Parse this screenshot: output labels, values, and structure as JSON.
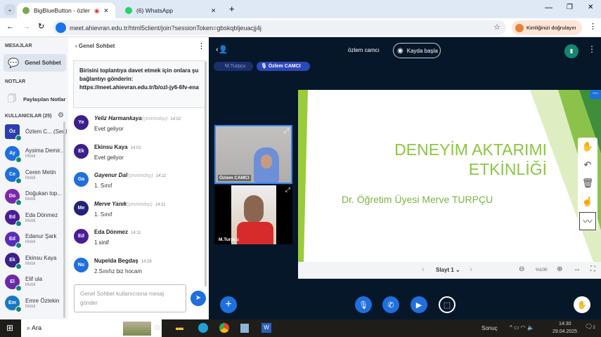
{
  "browser": {
    "tabs": [
      {
        "label": "BigBlueButton - özlem camcı"
      },
      {
        "label": "(6) WhatsApp"
      }
    ],
    "url": "meet.ahievran.edu.tr/html5client/join?sessionToken=gbskqbljeuacjj4j",
    "profile_label": "Kimliğinizi doğrulayın"
  },
  "sidebar": {
    "messages_header": "MESAJLAR",
    "public_chat": "Genel Sohbet",
    "notes_header": "NOTLAR",
    "shared_notes": "Paylaşılan Notlar",
    "users_header": "KULLANICILAR (25)",
    "users": [
      {
        "initials": "Öz",
        "name": "Özlem C...",
        "you": "(Sen)",
        "sub": "",
        "color": "#2e3dad"
      },
      {
        "initials": "Ay",
        "name": "Aysima Demir...",
        "sub": "Mobil",
        "color": "#1f6fdd"
      },
      {
        "initials": "Ce",
        "name": "Ceren Metin",
        "sub": "Mobil",
        "color": "#1f6fdd"
      },
      {
        "initials": "Do",
        "name": "Doğukan top...",
        "sub": "Mobil",
        "color": "#7a2aa8"
      },
      {
        "initials": "Ed",
        "name": "Eda Dönmez",
        "sub": "Mobil",
        "color": "#4a1d96"
      },
      {
        "initials": "Ed",
        "name": "Edanur Şark",
        "sub": "Mobil",
        "color": "#5b2cb8"
      },
      {
        "initials": "Ek",
        "name": "Ekinsu Kaya",
        "sub": "Mobil",
        "color": "#3b1f8c"
      },
      {
        "initials": "El",
        "name": "Elif ula",
        "sub": "Mobil",
        "color": "#6a2aa8"
      },
      {
        "initials": "Em",
        "name": "Emre Öztekin",
        "sub": "Mobil",
        "color": "#1a78c2"
      }
    ]
  },
  "chat": {
    "title": "Genel Sohbet",
    "invite": "Birisini toplantıya davet etmek için onlara şu bağlantıyı gönderin: https://meet.ahievran.edu.tr/b/ozl-jy6-6fv-ena",
    "messages": [
      {
        "initials": "Ye",
        "name": "Yeliz Harmankaya",
        "offline": "(çevrimdışı)",
        "time": "14:02",
        "text": "Evet geliyor",
        "color": "#3b1f8c"
      },
      {
        "initials": "Ek",
        "name": "Ekinsu Kaya",
        "offline": "",
        "time": "14:02",
        "text": "Evet geliyor",
        "color": "#3b1f8c"
      },
      {
        "initials": "Ga",
        "name": "Gayenur Dal",
        "offline": "(çevrimdışı)",
        "time": "14:11",
        "text": "1. Sınıf",
        "color": "#1f6fdd"
      },
      {
        "initials": "Me",
        "name": "Merve Yanık",
        "offline": "(çevrimdışı)",
        "time": "14:11",
        "text": "1. Sınıf",
        "color": "#25207a"
      },
      {
        "initials": "Ed",
        "name": "Eda Dönmez",
        "offline": "",
        "time": "14:11",
        "text": "1.sinif",
        "color": "#4a1d96"
      },
      {
        "initials": "Nu",
        "name": "Nupelda Begdaş",
        "offline": "",
        "time": "14:28",
        "text": "2.Sınıfız biz hocam",
        "color": "#1f6fdd"
      }
    ],
    "placeholder": "Genel Sohbet kullanıcısına mesaj gönder"
  },
  "meeting": {
    "title": "özlem camcı",
    "record": "Kayda başla",
    "talkers": [
      "M.Turpçu",
      "Özlem CAMCI"
    ],
    "videos": [
      "Özlem CAMCI",
      "M.Turpçu"
    ]
  },
  "slide": {
    "title1": "DENEYİM AKTARIMI",
    "title2": "ETKİNLİĞİ",
    "subtitle": "Dr. Öğretim Üyesi Merve TURPÇU",
    "slide_label": "Slayt 1",
    "zoom": "%100"
  },
  "taskbar": {
    "search": "Ara",
    "weather": "Sonuç",
    "time": "14:30",
    "date": "29.04.2025",
    "notif": "2"
  }
}
